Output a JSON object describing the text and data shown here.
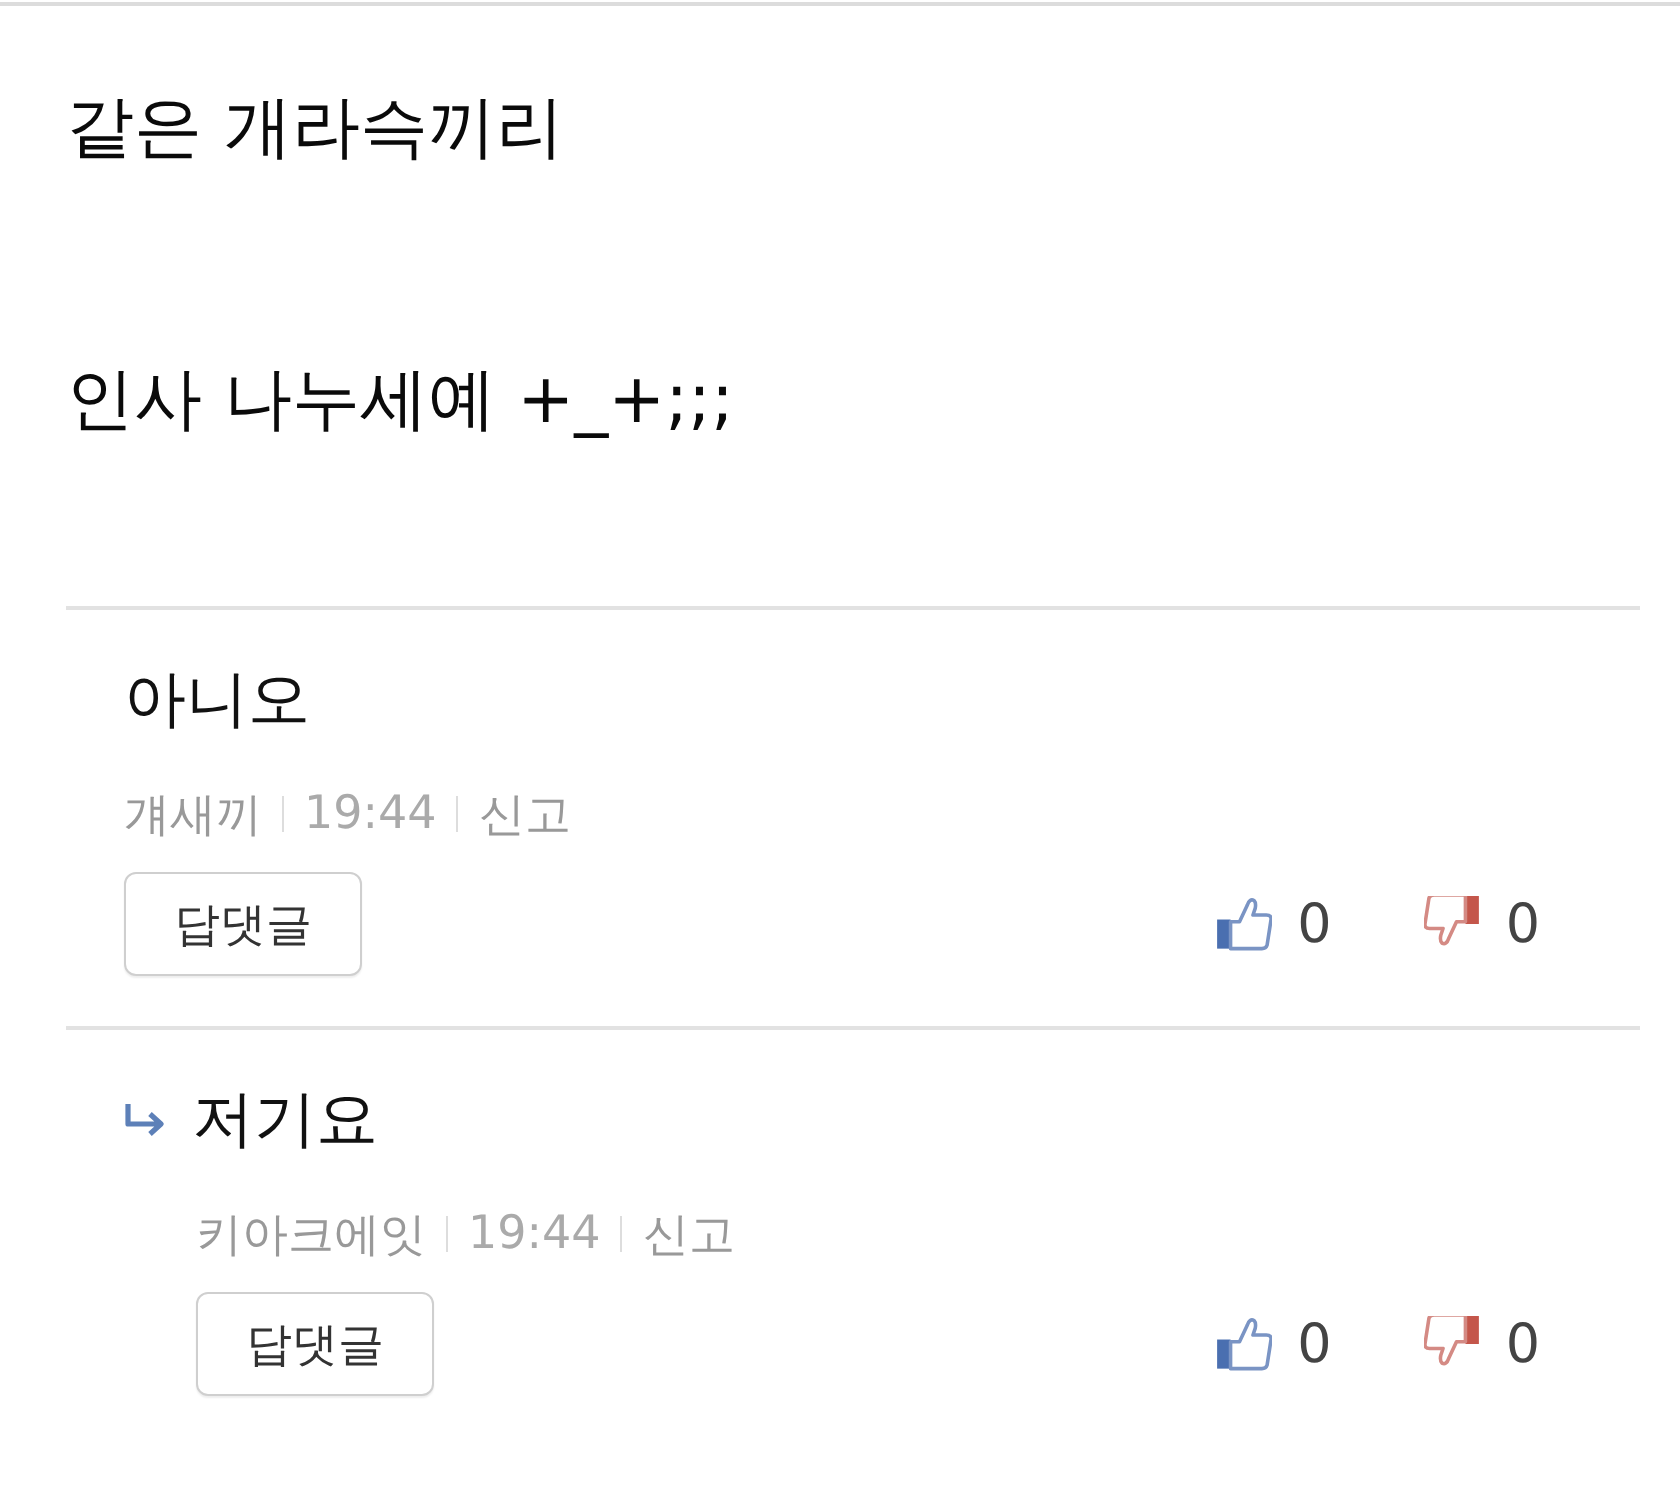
{
  "post": {
    "lines": [
      "같은 개라슥끼리",
      "인사 나누세예 +_+;;;"
    ]
  },
  "comments": [
    {
      "kind": "comment",
      "text": "아니오",
      "author": "걔새끼",
      "time": "19:44",
      "report": "신고",
      "reply_button": "답댓글",
      "likes": "0",
      "dislikes": "0"
    },
    {
      "kind": "reply",
      "text": "저기요",
      "author": "키아크에잇",
      "time": "19:44",
      "report": "신고",
      "reply_button": "답댓글",
      "likes": "0",
      "dislikes": "0"
    }
  ]
}
